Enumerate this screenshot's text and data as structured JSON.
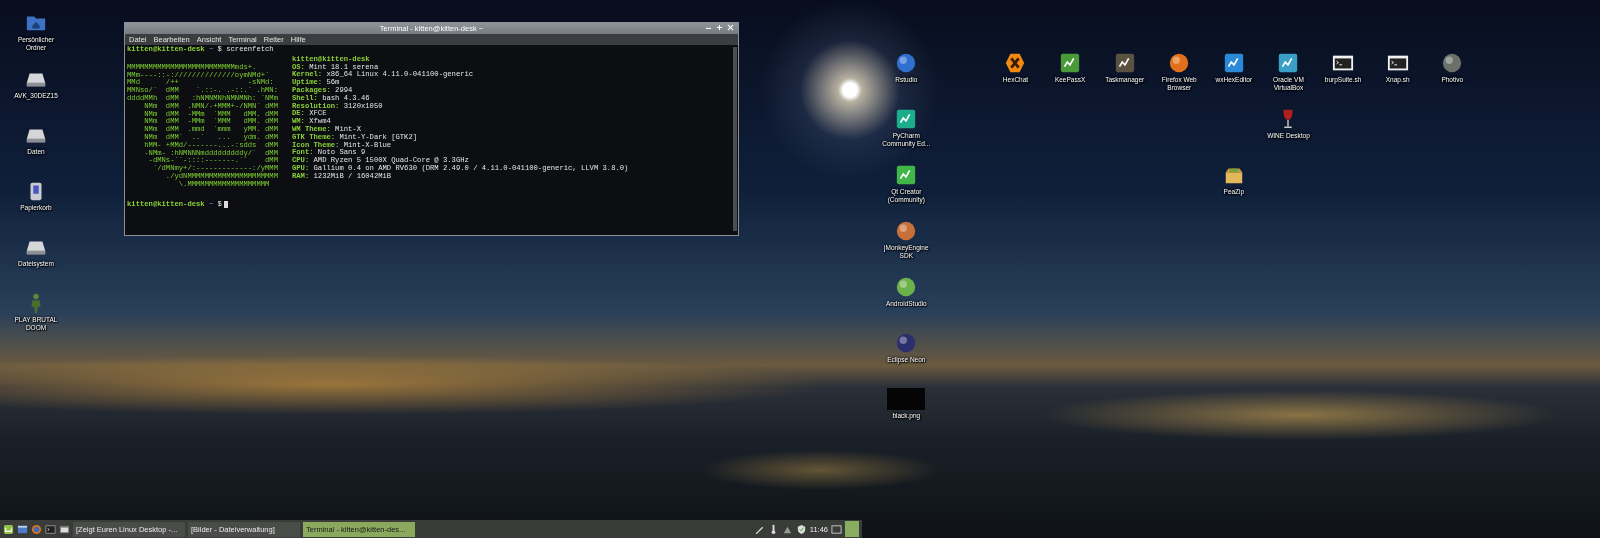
{
  "desktop_left_icons": [
    {
      "label": "Persönlicher Ordner"
    },
    {
      "label": "AVK_30DEZ15"
    },
    {
      "label": "Daten"
    },
    {
      "label": "Papierkorb"
    },
    {
      "label": "Dateisystem"
    },
    {
      "label": "PLAY BRUTAL DOOM"
    }
  ],
  "desktop_icons": [
    {
      "label": "Rstudio"
    },
    {
      "label": "HexChat"
    },
    {
      "label": "KeePassX"
    },
    {
      "label": "Taskmanager"
    },
    {
      "label": "Firefox Web Browser"
    },
    {
      "label": "wxHexEditor"
    },
    {
      "label": "Oracle VM VirtualBox"
    },
    {
      "label": "burpSuite.sh"
    },
    {
      "label": "Xnap.sh"
    },
    {
      "label": "Photivo"
    },
    {
      "label": "PyCharm Community Ed..."
    },
    {
      "label": "WINE Desktop"
    },
    {
      "label": "Qt Creator (Community)"
    },
    {
      "label": "PeaZip"
    },
    {
      "label": "jMonkeyEngine SDK"
    },
    {
      "label": "AndroidStudio"
    },
    {
      "label": "Eclipse Neon"
    },
    {
      "label": "black.png"
    }
  ],
  "terminal": {
    "title": "Terminal - kitten@kitten-desk ~",
    "menu": [
      "Datei",
      "Bearbeiten",
      "Ansicht",
      "Terminal",
      "Reiter",
      "Hilfe"
    ],
    "prompt": {
      "user": "kitten@kitten-desk",
      "path": "~",
      "symbol": "$",
      "command": "screenfetch"
    },
    "ascii_logo": [
      "MMMMMMMMMMMMMMMMMMMMMMMMMmds+.",
      "MMm----::-://////////////oymNMd+`",
      "MMd      /++                -sNMd:",
      "MMNso/`  dMM    `.::-. .-::.` .hMN:",
      "ddddMMh  dMM   :hNMNMNhNMNMNh: `NMm",
      "    NMm  dMM  .NMN/-+MMM+-/NMN` dMM",
      "    NMm  dMM  -MMm  `MMM   dMM. dMM",
      "    NMm  dMM  -MMm  `MMM   dMM. dMM",
      "    NMm  dMM  .mmd  `mmm   yMM. dMM",
      "    NMm  dMM`  ..`   ...   ydm. dMM",
      "    hMM- +MMd/-------...-:sdds  dMM",
      "    -NMm- :hNMNNNmdddddddddy/`  dMM",
      "     -dMNs-``-::::-------.``    dMM",
      "      `/dMNmy+/:-------------:/yMMM",
      "         ./ydNMMMMMMMMMMMMMMMMMMMMM",
      "            \\.MMMMMMMMMMMMMMMMMMM"
    ],
    "info_header": "kitten@kitten-desk",
    "info": [
      {
        "label": "OS:",
        "value": "Mint 18.1 serena"
      },
      {
        "label": "Kernel:",
        "value": "x86_64 Linux 4.11.0-041100-generic"
      },
      {
        "label": "Uptime:",
        "value": "56m"
      },
      {
        "label": "Packages:",
        "value": "2994"
      },
      {
        "label": "Shell:",
        "value": "bash 4.3.46"
      },
      {
        "label": "Resolution:",
        "value": "3120x1050"
      },
      {
        "label": "DE:",
        "value": "XFCE"
      },
      {
        "label": "WM:",
        "value": "Xfwm4"
      },
      {
        "label": "WM Theme:",
        "value": "Mint-X"
      },
      {
        "label": "GTK Theme:",
        "value": "Mint-Y-Dark [GTK2]"
      },
      {
        "label": "Icon Theme:",
        "value": "Mint-X-Blue"
      },
      {
        "label": "Font:",
        "value": "Noto Sans 9"
      },
      {
        "label": "CPU:",
        "value": "AMD Ryzen 5 1500X Quad-Core @ 3.3GHz"
      },
      {
        "label": "GPU:",
        "value": "Gallium 0.4 on AMD RV630 (DRM 2.49.0 / 4.11.0-041100-generic, LLVM 3.8.0)"
      },
      {
        "label": "RAM:",
        "value": "1232MiB / 16042MiB"
      }
    ],
    "final_prompt": {
      "user": "kitten@kitten-desk",
      "path": "~",
      "symbol": "$"
    }
  },
  "taskbar": {
    "tasks": [
      {
        "label": "[Zeigt Euren Linux Desktop -...",
        "selected": false
      },
      {
        "label": "[Bilder - Dateiverwaltung]",
        "selected": false
      },
      {
        "label": "Terminal - kitten@kitten-des...",
        "selected": true
      }
    ],
    "clock": "11:46"
  }
}
